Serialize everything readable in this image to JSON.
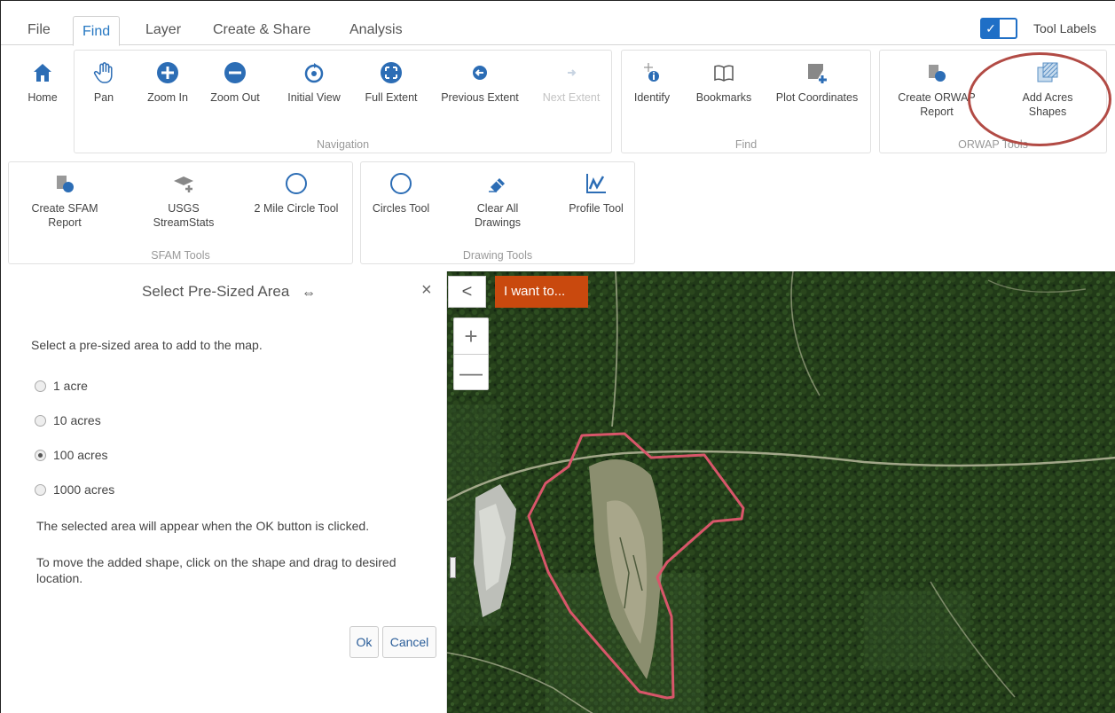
{
  "tabs": [
    {
      "label": "File"
    },
    {
      "label": "Find"
    },
    {
      "label": "Layer"
    },
    {
      "label": "Create & Share"
    },
    {
      "label": "Analysis"
    }
  ],
  "active_tab": "Find",
  "tool_labels_toggle": {
    "label": "Tool Labels",
    "checked": true
  },
  "ribbon": {
    "home": {
      "label": "Home",
      "icon": "home-icon"
    },
    "navigation": {
      "label": "Navigation",
      "tools": [
        {
          "label": "Pan",
          "icon": "hand-icon"
        },
        {
          "label": "Zoom In",
          "icon": "plus-circle-icon"
        },
        {
          "label": "Zoom Out",
          "icon": "minus-circle-icon"
        },
        {
          "label": "Initial View",
          "icon": "refresh-icon"
        },
        {
          "label": "Full Extent",
          "icon": "expand-icon"
        },
        {
          "label": "Previous Extent",
          "icon": "arrow-left-icon"
        },
        {
          "label": "Next Extent",
          "icon": "arrow-right-icon",
          "disabled": true
        }
      ]
    },
    "find": {
      "label": "Find",
      "tools": [
        {
          "label": "Identify",
          "icon": "identify-icon"
        },
        {
          "label": "Bookmarks",
          "icon": "book-icon"
        },
        {
          "label": "Plot Coordinates",
          "icon": "plot-coordinates-icon"
        }
      ]
    },
    "orwap": {
      "label": "ORWAP Tools",
      "tools": [
        {
          "label_1": "Create ORWAP",
          "label_2": "Report",
          "icon": "report-pie-icon"
        },
        {
          "label_1": "Add Acres",
          "label_2": "Shapes",
          "icon": "hatched-shapes-icon"
        }
      ]
    },
    "sfam": {
      "label": "SFAM Tools",
      "tools": [
        {
          "label_1": "Create SFAM",
          "label_2": "Report",
          "icon": "report-pie-icon"
        },
        {
          "label_1": "USGS",
          "label_2": "StreamStats",
          "icon": "layers-plus-icon"
        },
        {
          "label_1": "2 Mile Circle Tool",
          "label_2": "",
          "icon": "circle-icon"
        }
      ]
    },
    "drawing": {
      "label": "Drawing Tools",
      "tools": [
        {
          "label_1": "Circles Tool",
          "label_2": "",
          "icon": "circle-icon"
        },
        {
          "label_1": "Clear All",
          "label_2": "Drawings",
          "icon": "eraser-icon"
        },
        {
          "label_1": "Profile Tool",
          "label_2": "",
          "icon": "line-chart-icon"
        }
      ]
    }
  },
  "panel": {
    "title": "Select Pre-Sized Area",
    "prompt": "Select a pre-sized area to add to the map.",
    "options": [
      {
        "label": "1 acre",
        "checked": false
      },
      {
        "label": "10 acres",
        "checked": false
      },
      {
        "label": "100 acres",
        "checked": true
      },
      {
        "label": "1000 acres",
        "checked": false
      }
    ],
    "note_1": "The selected area will appear when the OK button is clicked.",
    "note_2": "To move the added shape, click on the shape and drag to desired location.",
    "ok_label": "Ok",
    "cancel_label": "Cancel"
  },
  "map": {
    "i_want_to": "I want to...",
    "zoom_in_glyph": "+",
    "zoom_out_glyph": "—",
    "collapse_glyph": "<"
  },
  "colors": {
    "accent": "#1f6fc6",
    "i_want_to_bg": "#c9490e",
    "shape_outline": "#d8566a",
    "annotation": "#b24b45"
  }
}
